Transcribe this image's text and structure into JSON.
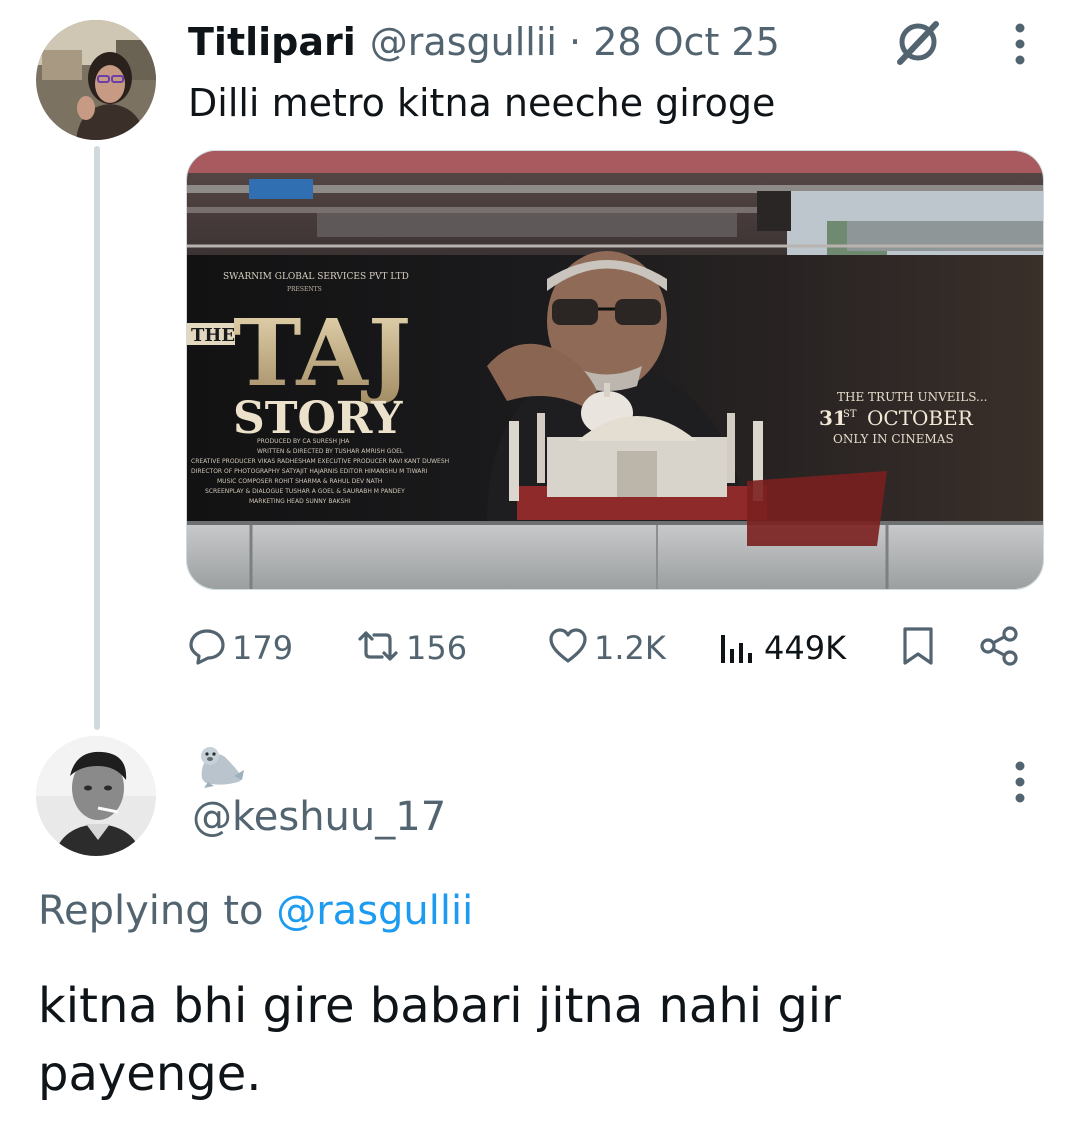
{
  "tweet": {
    "display_name": "Titlipari",
    "handle": "@rasgullii",
    "separator": "·",
    "date": "28 Oct 25",
    "text": "Dilli metro kitna neeche giroge",
    "poster": {
      "presenter": "SWARNIM GLOBAL SERVICES PVT LTD",
      "presents": "PRESENTS",
      "title_the": "THE",
      "title_taj": "TAJ",
      "title_story": "STORY",
      "release_line1": "THE TRUTH UNVEILS...",
      "release_day": "31",
      "release_sup": "ST",
      "release_month": "OCTOBER",
      "release_line3": "ONLY IN CINEMAS",
      "credits": [
        "PRODUCED BY CA SURESH JHA",
        "WRITTEN & DIRECTED BY TUSHAR AMRISH GOEL",
        "CREATIVE PRODUCER VIKAS RADHESHAM   EXECUTIVE PRODUCER RAVI KANT DUWESH",
        "DIRECTOR OF PHOTOGRAPHY SATYAJIT HAJARNIS   EDITOR HIMANSHU M TIWARI",
        "MUSIC COMPOSER ROHIT SHARMA & RAHUL DEV NATH",
        "SCREENPLAY & DIALOGUE TUSHAR A GOEL & SAURABH M PANDEY",
        "MARKETING HEAD SUNNY BAKSHI"
      ]
    },
    "stats": {
      "replies": "179",
      "reposts": "156",
      "likes": "1.2K",
      "views": "449K"
    }
  },
  "reply": {
    "name_emoji": "🦭",
    "handle": "@keshuu_17",
    "replying_prefix": "Replying to ",
    "replying_mention": "@rasgullii",
    "text": "kitna bhi gire babari jitna nahi gir payenge."
  },
  "icons": {
    "reply": "reply-icon",
    "repost": "repost-icon",
    "like": "heart-icon",
    "views": "analytics-icon",
    "bookmark": "bookmark-icon",
    "share": "share-icon",
    "grok": "grok-icon",
    "more": "more-vertical-icon"
  },
  "colors": {
    "text": "#0f1419",
    "secondary": "#536471",
    "accent": "#1d9bf0",
    "thread_line": "#cfd9de"
  }
}
